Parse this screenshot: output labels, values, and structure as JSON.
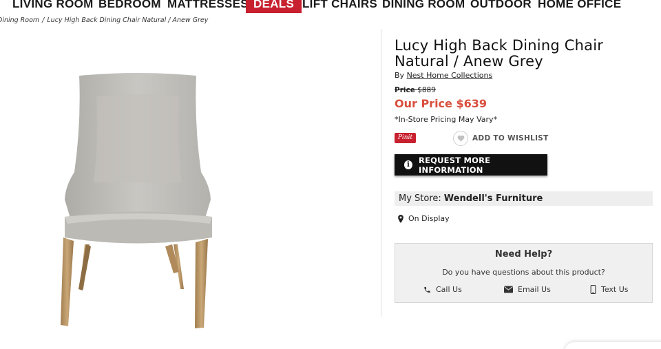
{
  "nav": {
    "items": [
      "LIVING ROOM",
      "BEDROOM",
      "MATTRESSES",
      "DEALS",
      "LIFT CHAIRS",
      "DINING ROOM",
      "OUTDOOR",
      "HOME OFFICE"
    ]
  },
  "breadcrumb": [
    "Dining Room",
    "Lucy High Back Dining Chair Natural / Anew Grey"
  ],
  "product": {
    "title": "Lucy High Back Dining Chair Natural / Anew Grey",
    "by_label": "By",
    "brand": "Nest Home Collections",
    "orig_price_label": "Price",
    "orig_price": "$889",
    "our_price": "Our Price $639",
    "instore_note": "*In-Store Pricing May Vary*"
  },
  "actions": {
    "pinit": "Pinit",
    "wishlist": "ADD TO WISHLIST",
    "request_info": "REQUEST MORE INFORMATION"
  },
  "store": {
    "label": "My Store:",
    "name": "Wendell's Furniture",
    "availability": "On Display"
  },
  "help": {
    "title": "Need Help?",
    "question": "Do you have questions about this product?",
    "call": "Call Us",
    "email": "Email Us",
    "text": "Text Us"
  },
  "colors": {
    "deals_bg": "#c8202f",
    "our_price": "#d94f3d",
    "button_bg": "#111111"
  },
  "icons": [
    "info-icon",
    "heart-icon",
    "map-pin-icon",
    "phone-icon",
    "envelope-icon",
    "mobile-phone-icon"
  ]
}
